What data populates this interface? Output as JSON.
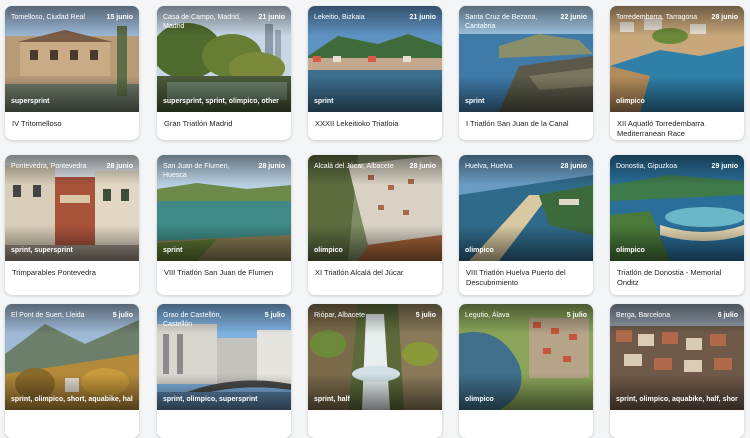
{
  "events": [
    {
      "location": "Tomelloso, Ciudad Real",
      "date": "15 junio",
      "tags": "supersprint",
      "title": "IV Tritomelloso"
    },
    {
      "location": "Casa de Campo, Madrid, Madrid",
      "date": "21 junio",
      "tags": "supersprint, sprint, olimpico, other",
      "title": "Gran Triatlón Madrid"
    },
    {
      "location": "Lekeitio, Bizkaia",
      "date": "21 junio",
      "tags": "sprint",
      "title": "XXXII Lekeitioko Triatloia"
    },
    {
      "location": "Santa Cruz de Bezana, Cantabria",
      "date": "22 junio",
      "tags": "sprint",
      "title": "I Triatlón San Juan de la Canal"
    },
    {
      "location": "Torredembarra, Tarragona",
      "date": "28 junio",
      "tags": "olimpico",
      "title": "XII Aquatló Torredembarra Mediterranean Race"
    },
    {
      "location": "Pontevedra, Pontevedra",
      "date": "28 junio",
      "tags": "sprint, supersprint",
      "title": "Trimparables Pontevedra"
    },
    {
      "location": "San Juan de Flumen, Huesca",
      "date": "28 junio",
      "tags": "sprint",
      "title": "VIII Triatlón San Juan de Flumen"
    },
    {
      "location": "Alcalá del Júcar, Albacete",
      "date": "28 junio",
      "tags": "olimpico",
      "title": "XI Triatlón Alcalá del Júcar"
    },
    {
      "location": "Huelva, Huelva",
      "date": "28 junio",
      "tags": "olimpico",
      "title": "VIII Triatlón Huelva Puerto del Descubrimiento"
    },
    {
      "location": "Donostia, Gipuzkoa",
      "date": "29 junio",
      "tags": "olimpico",
      "title": "Triatlón de Donostia - Memorial Onditz"
    },
    {
      "location": "El Pont de Suert, Lleida",
      "date": "5 julio",
      "tags": "sprint, olimpico, short, aquabike, half",
      "title": ""
    },
    {
      "location": "Grao de Castellón, Castellón",
      "date": "5 julio",
      "tags": "sprint, olimpico, supersprint",
      "title": ""
    },
    {
      "location": "Riópar, Albacete",
      "date": "5 julio",
      "tags": "sprint, half",
      "title": ""
    },
    {
      "location": "Legutio, Álava",
      "date": "5 julio",
      "tags": "olimpico",
      "title": ""
    },
    {
      "location": "Berga, Barcelona",
      "date": "6 julio",
      "tags": "sprint, olimpico, aquabike, half, short",
      "title": ""
    }
  ]
}
